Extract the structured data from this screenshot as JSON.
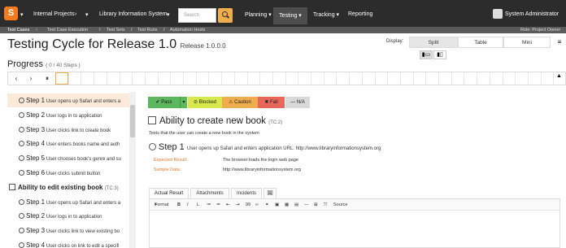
{
  "nav": {
    "logo": "S",
    "items": [
      "Internal Projects",
      "Library Information System",
      "Planning",
      "Testing",
      "Tracking",
      "Reporting"
    ],
    "search_placeholder": "Search",
    "user": "System Administrator"
  },
  "breadcrumb": {
    "items": [
      "Test Cases",
      "Test Case Execution",
      "Test Sets",
      "Test Runs",
      "Automation Hosts"
    ],
    "role": "Role: Project Owner"
  },
  "page": {
    "title": "Testing Cycle for Release 1.0",
    "release": "Release 1.0.0.0",
    "display_label": "Display:",
    "display_options": [
      "Split",
      "Table",
      "Mini"
    ],
    "selected_display": "Split",
    "menu_icon": "≡",
    "layout_buttons": [
      "▮▭",
      "▮▯"
    ]
  },
  "progress": {
    "label": "Progress",
    "count": "( 0 / 40 Steps )",
    "total_steps": 40,
    "completed_steps": 0,
    "controls": [
      "‹",
      "›",
      "⏸"
    ],
    "corner_icon": "▲"
  },
  "sidebar": {
    "rows": [
      {
        "kind": "step",
        "step": "Step 1",
        "text": "User opens up Safari and enters a",
        "selected": true
      },
      {
        "kind": "step",
        "step": "Step 2",
        "text": "User logs in to application",
        "selected": false
      },
      {
        "kind": "step",
        "step": "Step 3",
        "text": "User clicks link to create book",
        "selected": false
      },
      {
        "kind": "step",
        "step": "Step 4",
        "text": "User enters books name and auth",
        "selected": false
      },
      {
        "kind": "step",
        "step": "Step 5",
        "text": "User chooses book's genre and su",
        "selected": false
      },
      {
        "kind": "step",
        "step": "Step 6",
        "text": "User clicks submit button",
        "selected": false
      },
      {
        "kind": "case",
        "title": "Ability to edit existing book",
        "tc": "(TC:3)"
      },
      {
        "kind": "step",
        "step": "Step 1",
        "text": "User opens up Safari and enters a",
        "selected": false
      },
      {
        "kind": "step",
        "step": "Step 2",
        "text": "User logs in to application",
        "selected": false
      },
      {
        "kind": "step",
        "step": "Step 3",
        "text": "User clicks link to view existing bo",
        "selected": false
      },
      {
        "kind": "step",
        "step": "Step 4",
        "text": "User clicks on link to edit a specifi",
        "selected": false
      }
    ]
  },
  "actions": {
    "pass": "✔ Pass",
    "pass_dropdown": "▾",
    "blocked": "⊘ Blocked",
    "caution": "⚠ Caution",
    "fail": "✖ Fail",
    "na": "— N/A",
    "colors": {
      "pass": "#5cb85c",
      "blocked": "#d9e94c",
      "caution": "#f0ad4e",
      "fail": "#e9665a",
      "na": "#d9d9d9"
    }
  },
  "case": {
    "title": "Ability to create new book",
    "tc": "(TC:2)",
    "description": "Tests that the user can create a new book in the system",
    "step_label": "Step 1",
    "step_text": "User opens up Safari and enters application URL: http://www.libraryinformationsystem.org",
    "expected_label": "Expected Result:",
    "expected_value": "The browser loads the login web page",
    "sample_label": "Sample Data:",
    "sample_value": "http://www.libraryinformationsystem.org"
  },
  "tabs": [
    "Actual Result",
    "Attachments",
    "Incidents",
    "🖼"
  ],
  "editor": {
    "format_label": "Format",
    "tools": [
      "B",
      "I",
      "I̶",
      "≔",
      "≕",
      "⇤",
      "⇥",
      "99",
      "∞",
      "⚭",
      "▣",
      "▦",
      "▤",
      "—",
      "⊞",
      "⤧",
      "Source"
    ]
  }
}
